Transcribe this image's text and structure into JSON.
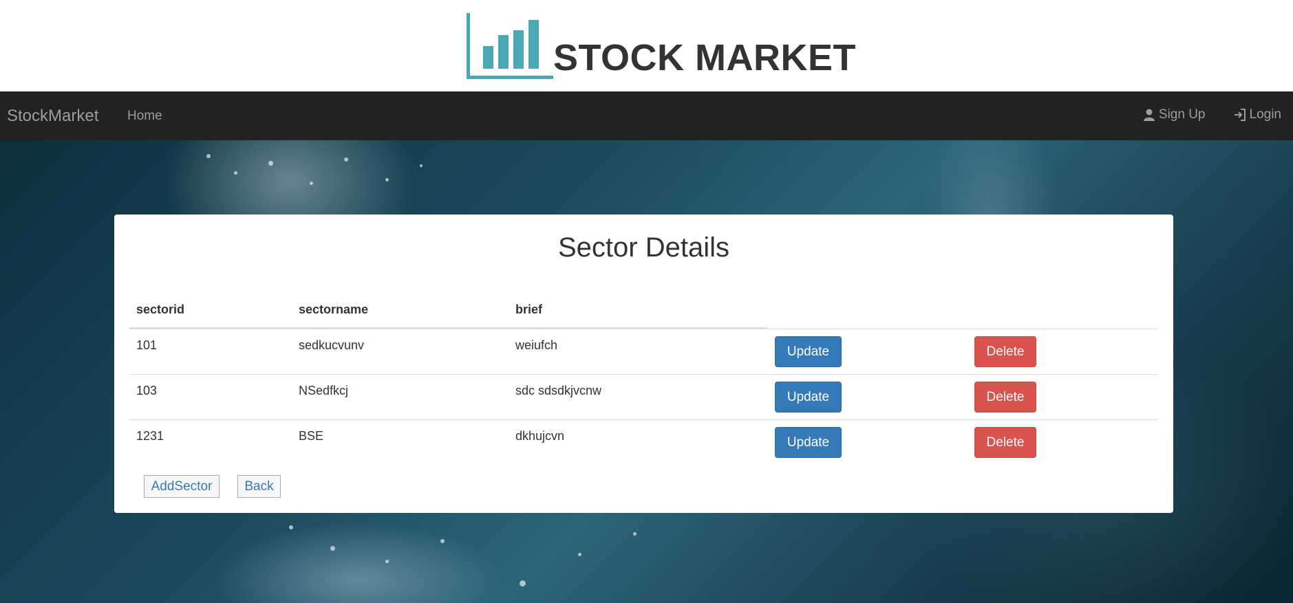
{
  "header": {
    "logo_text": "STOCK MARKET",
    "logo_icon": "bar-chart-logo-icon",
    "logo_color": "#4aa8b2"
  },
  "navbar": {
    "brand": "StockMarket",
    "home": "Home",
    "signup": "Sign Up",
    "login": "Login",
    "signup_icon": "user-icon",
    "login_icon": "login-icon"
  },
  "panel": {
    "title": "Sector Details",
    "columns": [
      "sectorid",
      "sectorname",
      "brief"
    ],
    "rows": [
      {
        "sectorid": "101",
        "sectorname": "sedkucvunv",
        "brief": "weiufch",
        "update": "Update",
        "delete": "Delete"
      },
      {
        "sectorid": "103",
        "sectorname": "NSedfkcj",
        "brief": "sdc sdsdkjvcnw",
        "update": "Update",
        "delete": "Delete"
      },
      {
        "sectorid": "1231",
        "sectorname": "BSE",
        "brief": "dkhujcvn",
        "update": "Update",
        "delete": "Delete"
      }
    ],
    "add_button": "AddSector",
    "back_button": "Back"
  },
  "colors": {
    "navbar_bg": "#222222",
    "primary": "#337ab7",
    "danger": "#d9534f"
  }
}
